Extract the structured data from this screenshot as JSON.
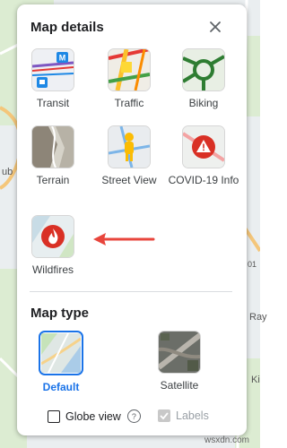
{
  "panel": {
    "title": "Map details",
    "close_icon": "close-icon"
  },
  "map_details": [
    {
      "id": "transit",
      "label": "Transit",
      "icon": "transit-thumb"
    },
    {
      "id": "traffic",
      "label": "Traffic",
      "icon": "traffic-thumb"
    },
    {
      "id": "biking",
      "label": "Biking",
      "icon": "biking-thumb"
    },
    {
      "id": "terrain",
      "label": "Terrain",
      "icon": "terrain-thumb"
    },
    {
      "id": "street-view",
      "label": "Street View",
      "icon": "street-view-thumb"
    },
    {
      "id": "covid",
      "label": "COVID-19 Info",
      "icon": "covid-info-thumb"
    },
    {
      "id": "wildfires",
      "label": "Wildfires",
      "icon": "wildfires-thumb"
    }
  ],
  "transit_badge": "M",
  "map_type": {
    "title": "Map type",
    "options": [
      {
        "label": "Default",
        "selected": true
      },
      {
        "label": "Satellite",
        "selected": false
      }
    ]
  },
  "options": {
    "globe_view": "Globe view",
    "labels": "Labels",
    "labels_checked": true,
    "globe_checked": false
  },
  "background_labels": {
    "left": "ub",
    "right_top": "01",
    "right_mid": "Ray",
    "right_bottom": "Ki"
  },
  "watermark": "wsxdn.com",
  "colors": {
    "accent": "#1a73e8",
    "arrow": "#e8453c",
    "covid": "#d93025"
  }
}
